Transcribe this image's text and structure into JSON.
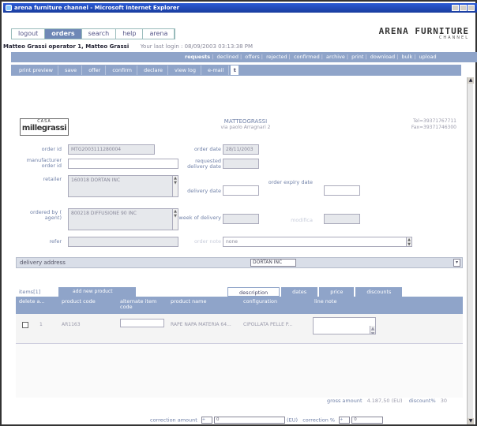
{
  "window": {
    "title": "arena furniture channel - Microsoft Internet Explorer"
  },
  "topnav": {
    "tabs": [
      {
        "label": "logout"
      },
      {
        "label": "orders"
      },
      {
        "label": "search"
      },
      {
        "label": "help"
      },
      {
        "label": "arena"
      }
    ]
  },
  "brand": {
    "name": "ARENA FURNITURE",
    "sub": "CHANNEL"
  },
  "user": {
    "line": "Matteo Grassi operator 1, Matteo Grassi",
    "last_login": "Your last login : 08/09/2003 03:13:38 PM"
  },
  "actionbar": {
    "items": [
      "requests",
      "declined",
      "offers",
      "rejected",
      "confirmed",
      "archive",
      "print",
      "download",
      "bulk",
      "upload"
    ]
  },
  "toolbar": {
    "items": [
      "print preview",
      "save",
      "offer",
      "confirm",
      "declare",
      "view log",
      "e-mail"
    ],
    "t_button": "t"
  },
  "header": {
    "logo_small": "CASA",
    "logo_big": "millegrassi",
    "customer_name": "MATTEOGRASSI",
    "customer_addr": "via paolo Arragnari 2",
    "phones": [
      "Tel=39371767711",
      "Fax=39371746300"
    ]
  },
  "form": {
    "order_id_label": "order id",
    "order_id_value": "MTG2003111280004",
    "manufacturer_order_id_label": "manufacturer order id",
    "manufacturer_order_id_value": "",
    "retailer_label": "retailer",
    "retailer_value": "160018 DORTAN INC",
    "ordered_by_label": "ordered by ( agent)",
    "ordered_by_value": "800218 DIFFUSIONE 90 INC",
    "refer_label": "refer",
    "refer_value": "",
    "order_date_label": "order date",
    "order_date_value": "28/11/2003",
    "requested_delivery_date_label": "requested delivery date",
    "requested_delivery_date_value": "",
    "delivery_date_label": "delivery date",
    "delivery_date_value": "",
    "order_expiry_date_label": "order expiry date",
    "order_expiry_date_value": "",
    "week_of_delivery_label": "week of delivery",
    "week_of_delivery_value": "",
    "mod_label": "modifica",
    "mod_value": "",
    "order_note_label": "order note",
    "order_note_value": "none"
  },
  "delivery": {
    "label": "delivery address",
    "selected": "DORTAN INC"
  },
  "items": {
    "count_label": "items[1]",
    "add_button": "add new product",
    "tabs": [
      "description",
      "dates",
      "price",
      "discounts"
    ],
    "columns": [
      "delete a...",
      "product code",
      "alternate item code",
      "product name",
      "configuration",
      "line note"
    ],
    "rows": [
      {
        "num": "1",
        "code": "AR1163",
        "alt_code": "",
        "name": "RAPE NAPA MATERIA 64...",
        "config": "CIPOLLATA PELLE P...",
        "note": ""
      }
    ]
  },
  "totals": {
    "gross_label": "gross amount",
    "gross_value": "4.187,50 (EU)",
    "discount_label": "discount%",
    "discount_value": "30"
  },
  "correction": {
    "amount_label": "correction amount",
    "amount_sign": "+",
    "amount_value": "0",
    "currency": "(EU)",
    "pct_label": "correction %",
    "pct_sign": "+",
    "pct_value": "0"
  }
}
